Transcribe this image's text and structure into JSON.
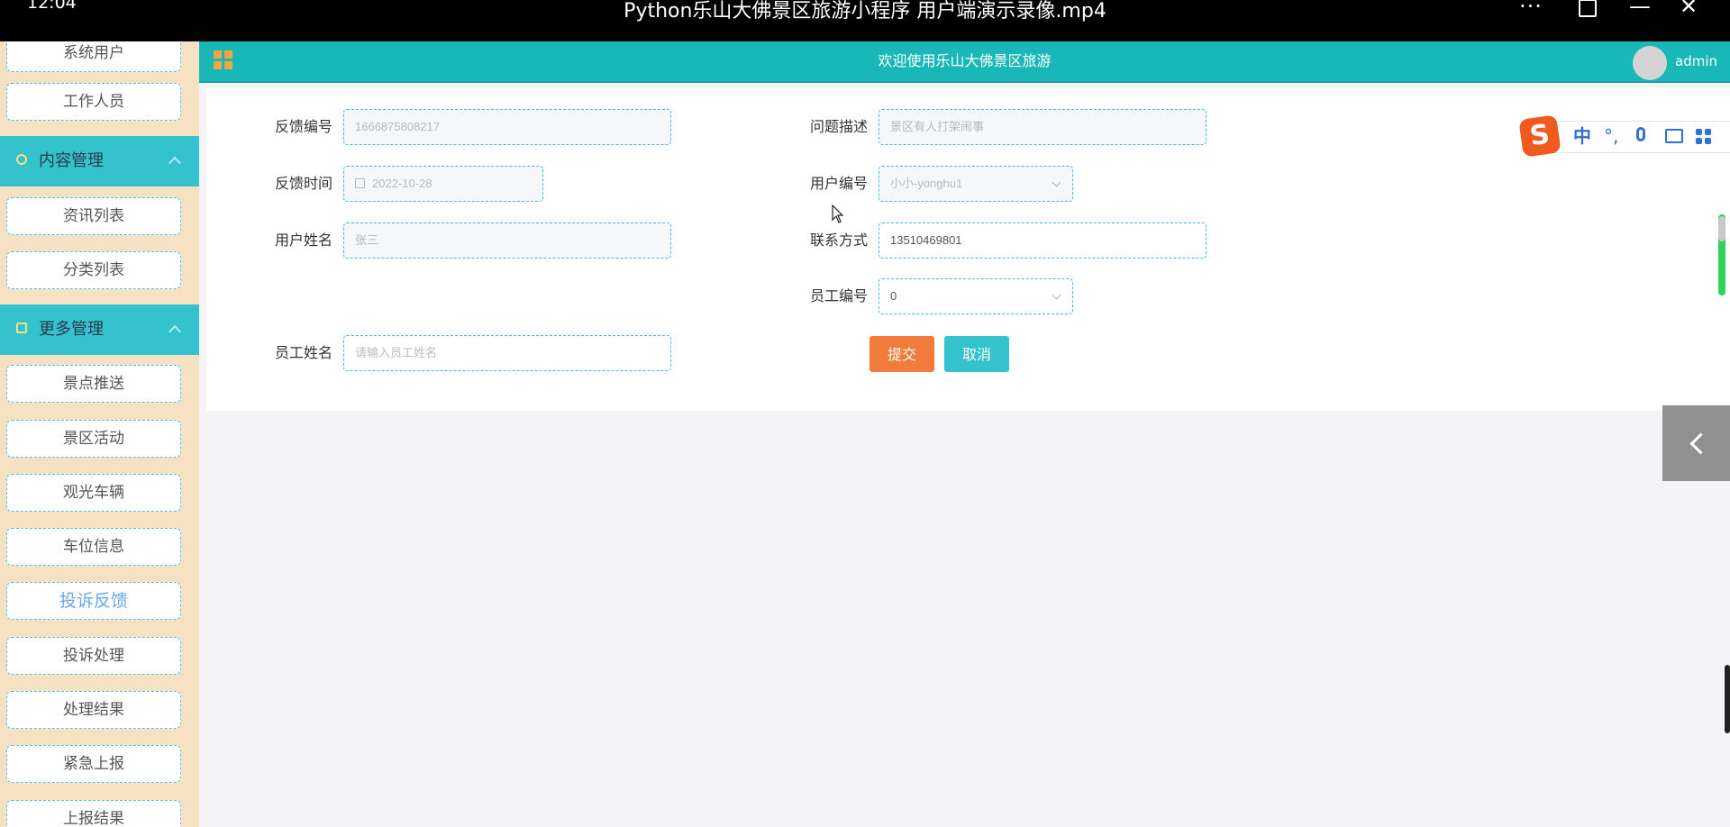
{
  "player": {
    "clock": "12:04",
    "title": "Python乐山大佛景区旅游小程序  用户端演示录像.mp4",
    "more": "···",
    "minimize": "—",
    "close": "✕"
  },
  "sidebar": {
    "top_items": [
      "系统用户",
      "工作人员"
    ],
    "groups": [
      {
        "label": "内容管理",
        "items": [
          "资讯列表",
          "分类列表"
        ]
      },
      {
        "label": "更多管理",
        "items": [
          "景点推送",
          "景区活动",
          "观光车辆",
          "车位信息",
          "投诉反馈",
          "投诉处理",
          "处理结果",
          "紧急上报",
          "上报结果"
        ]
      }
    ],
    "active_item": "投诉反馈"
  },
  "header": {
    "title": "欢迎使用乐山大佛景区旅游",
    "username": "admin"
  },
  "form": {
    "fields": {
      "feedback_no": {
        "label": "反馈编号",
        "value": "1666875808217"
      },
      "problem_desc": {
        "label": "问题描述",
        "value": "景区有人打架闹事"
      },
      "feedback_time": {
        "label": "反馈时间",
        "value": "2022-10-28"
      },
      "user_no": {
        "label": "用户编号",
        "value": "小小-yonghu1"
      },
      "user_name": {
        "label": "用户姓名",
        "value": "张三"
      },
      "contact": {
        "label": "联系方式",
        "value": "13510469801"
      },
      "staff_no": {
        "label": "员工编号",
        "value": "0"
      },
      "staff_name": {
        "label": "员工姓名",
        "placeholder": "请输入员工姓名"
      }
    },
    "buttons": {
      "submit": "提交",
      "cancel": "取消"
    }
  },
  "ime": {
    "logo": "S",
    "mode": "中",
    "punct": "°,"
  },
  "colors": {
    "header": "#19b7b7",
    "sidebar_bg": "#f6e2c3",
    "group_bg": "#34c2cc",
    "submit": "#f07b3a",
    "cancel": "#34c3cc"
  }
}
